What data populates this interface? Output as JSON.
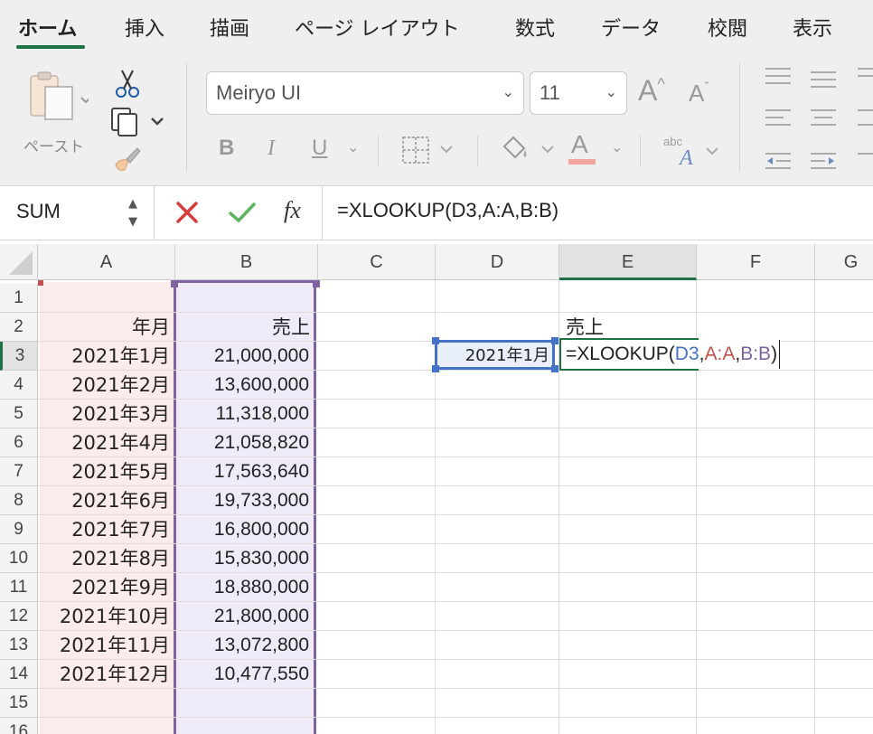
{
  "ribbon": {
    "tabs": [
      {
        "label": "ホーム",
        "active": true
      },
      {
        "label": "挿入"
      },
      {
        "label": "描画"
      },
      {
        "label": "ページ レイアウト"
      },
      {
        "label": "数式"
      },
      {
        "label": "データ"
      },
      {
        "label": "校閲"
      },
      {
        "label": "表示"
      }
    ],
    "paste_label": "ペースト",
    "font_name": "Meiryo UI",
    "font_size": "11",
    "bold_label": "B",
    "italic_label": "I",
    "underline_label": "U",
    "grow_font_label": "A",
    "shrink_font_label": "A",
    "font_color_label": "A",
    "orientation_label": "abc",
    "accent_color": "#1e7145"
  },
  "formula_bar": {
    "name_box": "SUM",
    "fx_label": "fx",
    "formula": "=XLOOKUP(D3,A:A,B:B)"
  },
  "sheet": {
    "columns": [
      "A",
      "B",
      "C",
      "D",
      "E",
      "F",
      "G"
    ],
    "rows": [
      "1",
      "2",
      "3",
      "4",
      "5",
      "6",
      "7",
      "8",
      "9",
      "10",
      "11",
      "12",
      "13",
      "14",
      "15",
      "16"
    ],
    "header_a": "年月",
    "header_b": "売上",
    "data": [
      {
        "month": "2021年1月",
        "sales": "21,000,000"
      },
      {
        "month": "2021年2月",
        "sales": "13,600,000"
      },
      {
        "month": "2021年3月",
        "sales": "11,318,000"
      },
      {
        "month": "2021年4月",
        "sales": "21,058,820"
      },
      {
        "month": "2021年5月",
        "sales": "17,563,640"
      },
      {
        "month": "2021年6月",
        "sales": "19,733,000"
      },
      {
        "month": "2021年7月",
        "sales": "16,800,000"
      },
      {
        "month": "2021年8月",
        "sales": "15,830,000"
      },
      {
        "month": "2021年9月",
        "sales": "18,880,000"
      },
      {
        "month": "2021年10月",
        "sales": "21,800,000"
      },
      {
        "month": "2021年11月",
        "sales": "13,072,800"
      },
      {
        "month": "2021年12月",
        "sales": "10,477,550"
      }
    ],
    "lookup_value": "2021年1月",
    "result_header": "売上",
    "editing_formula": {
      "prefix": "=XLOOKUP(",
      "arg1": "D3",
      "comma1": ",",
      "arg2": "A:A",
      "comma2": ",",
      "arg3": "B:B",
      "suffix": ")"
    },
    "colors": {
      "ref_blue": "#4472c4",
      "ref_red": "#c0504d",
      "ref_purple": "#8064a2",
      "fill_red": "#fbeceb",
      "fill_purple": "#efebf8",
      "fill_blue": "#e8eff8"
    }
  }
}
